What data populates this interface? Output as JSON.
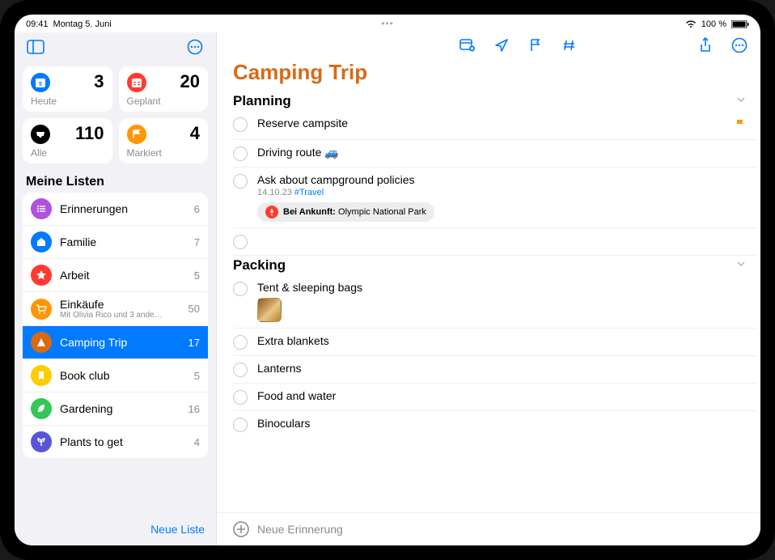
{
  "status": {
    "time": "09:41",
    "date": "Montag 5. Juni",
    "battery": "100 %"
  },
  "sidebar": {
    "cards": {
      "today": {
        "label": "Heute",
        "count": "3",
        "color": "#007aff",
        "icon": "calendar"
      },
      "planned": {
        "label": "Geplant",
        "count": "20",
        "color": "#ff3b30",
        "icon": "calendar"
      },
      "all": {
        "label": "Alle",
        "count": "110",
        "color": "#000000",
        "icon": "inbox"
      },
      "flagged": {
        "label": "Markiert",
        "count": "4",
        "color": "#ff9500",
        "icon": "flag"
      }
    },
    "section_title": "Meine Listen",
    "lists": [
      {
        "name": "Erinnerungen",
        "count": "6",
        "color": "#af52de",
        "icon": "list"
      },
      {
        "name": "Familie",
        "count": "7",
        "color": "#007aff",
        "icon": "house"
      },
      {
        "name": "Arbeit",
        "count": "5",
        "color": "#ff3b30",
        "icon": "star"
      },
      {
        "name": "Einkäufe",
        "count": "50",
        "color": "#ff9500",
        "icon": "cart",
        "sub": "Mit Olivia Rico und 3 ande…"
      },
      {
        "name": "Camping Trip",
        "count": "17",
        "color": "#d86a14",
        "icon": "tent",
        "selected": true
      },
      {
        "name": "Book club",
        "count": "5",
        "color": "#ffcc00",
        "icon": "bookmark"
      },
      {
        "name": "Gardening",
        "count": "16",
        "color": "#34c759",
        "icon": "leaf"
      },
      {
        "name": "Plants to get",
        "count": "4",
        "color": "#5856d6",
        "icon": "sprout"
      }
    ],
    "new_list": "Neue Liste"
  },
  "main": {
    "title": "Camping Trip",
    "sections": [
      {
        "title": "Planning",
        "items": [
          {
            "title": "Reserve campsite",
            "flagged": true
          },
          {
            "title": "Driving route 🚙"
          },
          {
            "title": "Ask about campground policies",
            "date": "14.10.23",
            "tag": "#Travel",
            "pill_bold": "Bei Ankunft:",
            "pill_text": " Olympic National Park"
          },
          {
            "title": ""
          }
        ]
      },
      {
        "title": "Packing",
        "items": [
          {
            "title": "Tent & sleeping bags",
            "thumb": true
          },
          {
            "title": "Extra blankets"
          },
          {
            "title": "Lanterns"
          },
          {
            "title": "Food and water"
          },
          {
            "title": "Binoculars"
          }
        ]
      }
    ],
    "new_reminder": "Neue Erinnerung"
  }
}
